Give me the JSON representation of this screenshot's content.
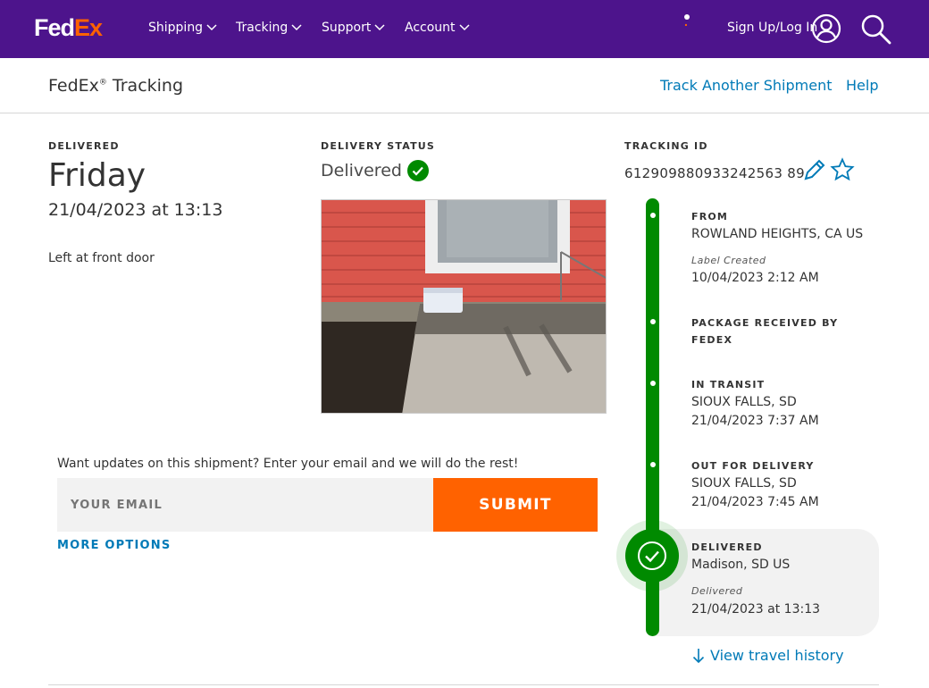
{
  "nav": {
    "logo_fed": "Fed",
    "logo_ex": "Ex",
    "items": [
      {
        "label": "Shipping"
      },
      {
        "label": "Tracking"
      },
      {
        "label": "Support"
      },
      {
        "label": "Account"
      }
    ],
    "signin_label": "Sign Up/Log In",
    "icons": [
      "user-icon",
      "search-icon",
      "chevron-down-icon"
    ]
  },
  "subheader": {
    "brand": "FedEx",
    "brand_mark": "®",
    "brand_suffix": " Tracking",
    "track_another": "Track Another Shipment",
    "help": "Help"
  },
  "delivery": {
    "label": "DELIVERED",
    "day": "Friday",
    "datetime": "21/04/2023 at 13:13",
    "note": "Left at front door"
  },
  "status": {
    "label": "DELIVERY STATUS",
    "value": "Delivered"
  },
  "tracking": {
    "label": "TRACKING ID",
    "number": "612909880933242563 89"
  },
  "email": {
    "prompt": "Want updates on this shipment? Enter your email and we will do the rest!",
    "placeholder": "YOUR EMAIL",
    "submit": "SUBMIT",
    "more_options": "MORE OPTIONS"
  },
  "timeline": {
    "events": [
      {
        "title": "FROM",
        "location": "ROWLAND HEIGHTS, CA US",
        "sublabel": "Label Created",
        "date": "10/04/2023 2:12 AM"
      },
      {
        "title": "PACKAGE RECEIVED BY",
        "title2": "FEDEX"
      },
      {
        "title": "IN TRANSIT",
        "location": "SIOUX FALLS, SD",
        "date": "21/04/2023 7:37 AM"
      },
      {
        "title": "OUT FOR DELIVERY",
        "location": "SIOUX FALLS, SD",
        "date": "21/04/2023 7:45 AM"
      },
      {
        "title": "DELIVERED",
        "location": "Madison, SD US",
        "sublabel": "Delivered",
        "date": "21/04/2023 at 13:13"
      }
    ],
    "view_history": "View travel history"
  },
  "colors": {
    "brand_purple": "#4d148c",
    "brand_orange": "#ff6200",
    "link_blue": "#007ab7",
    "status_green": "#008a00"
  }
}
